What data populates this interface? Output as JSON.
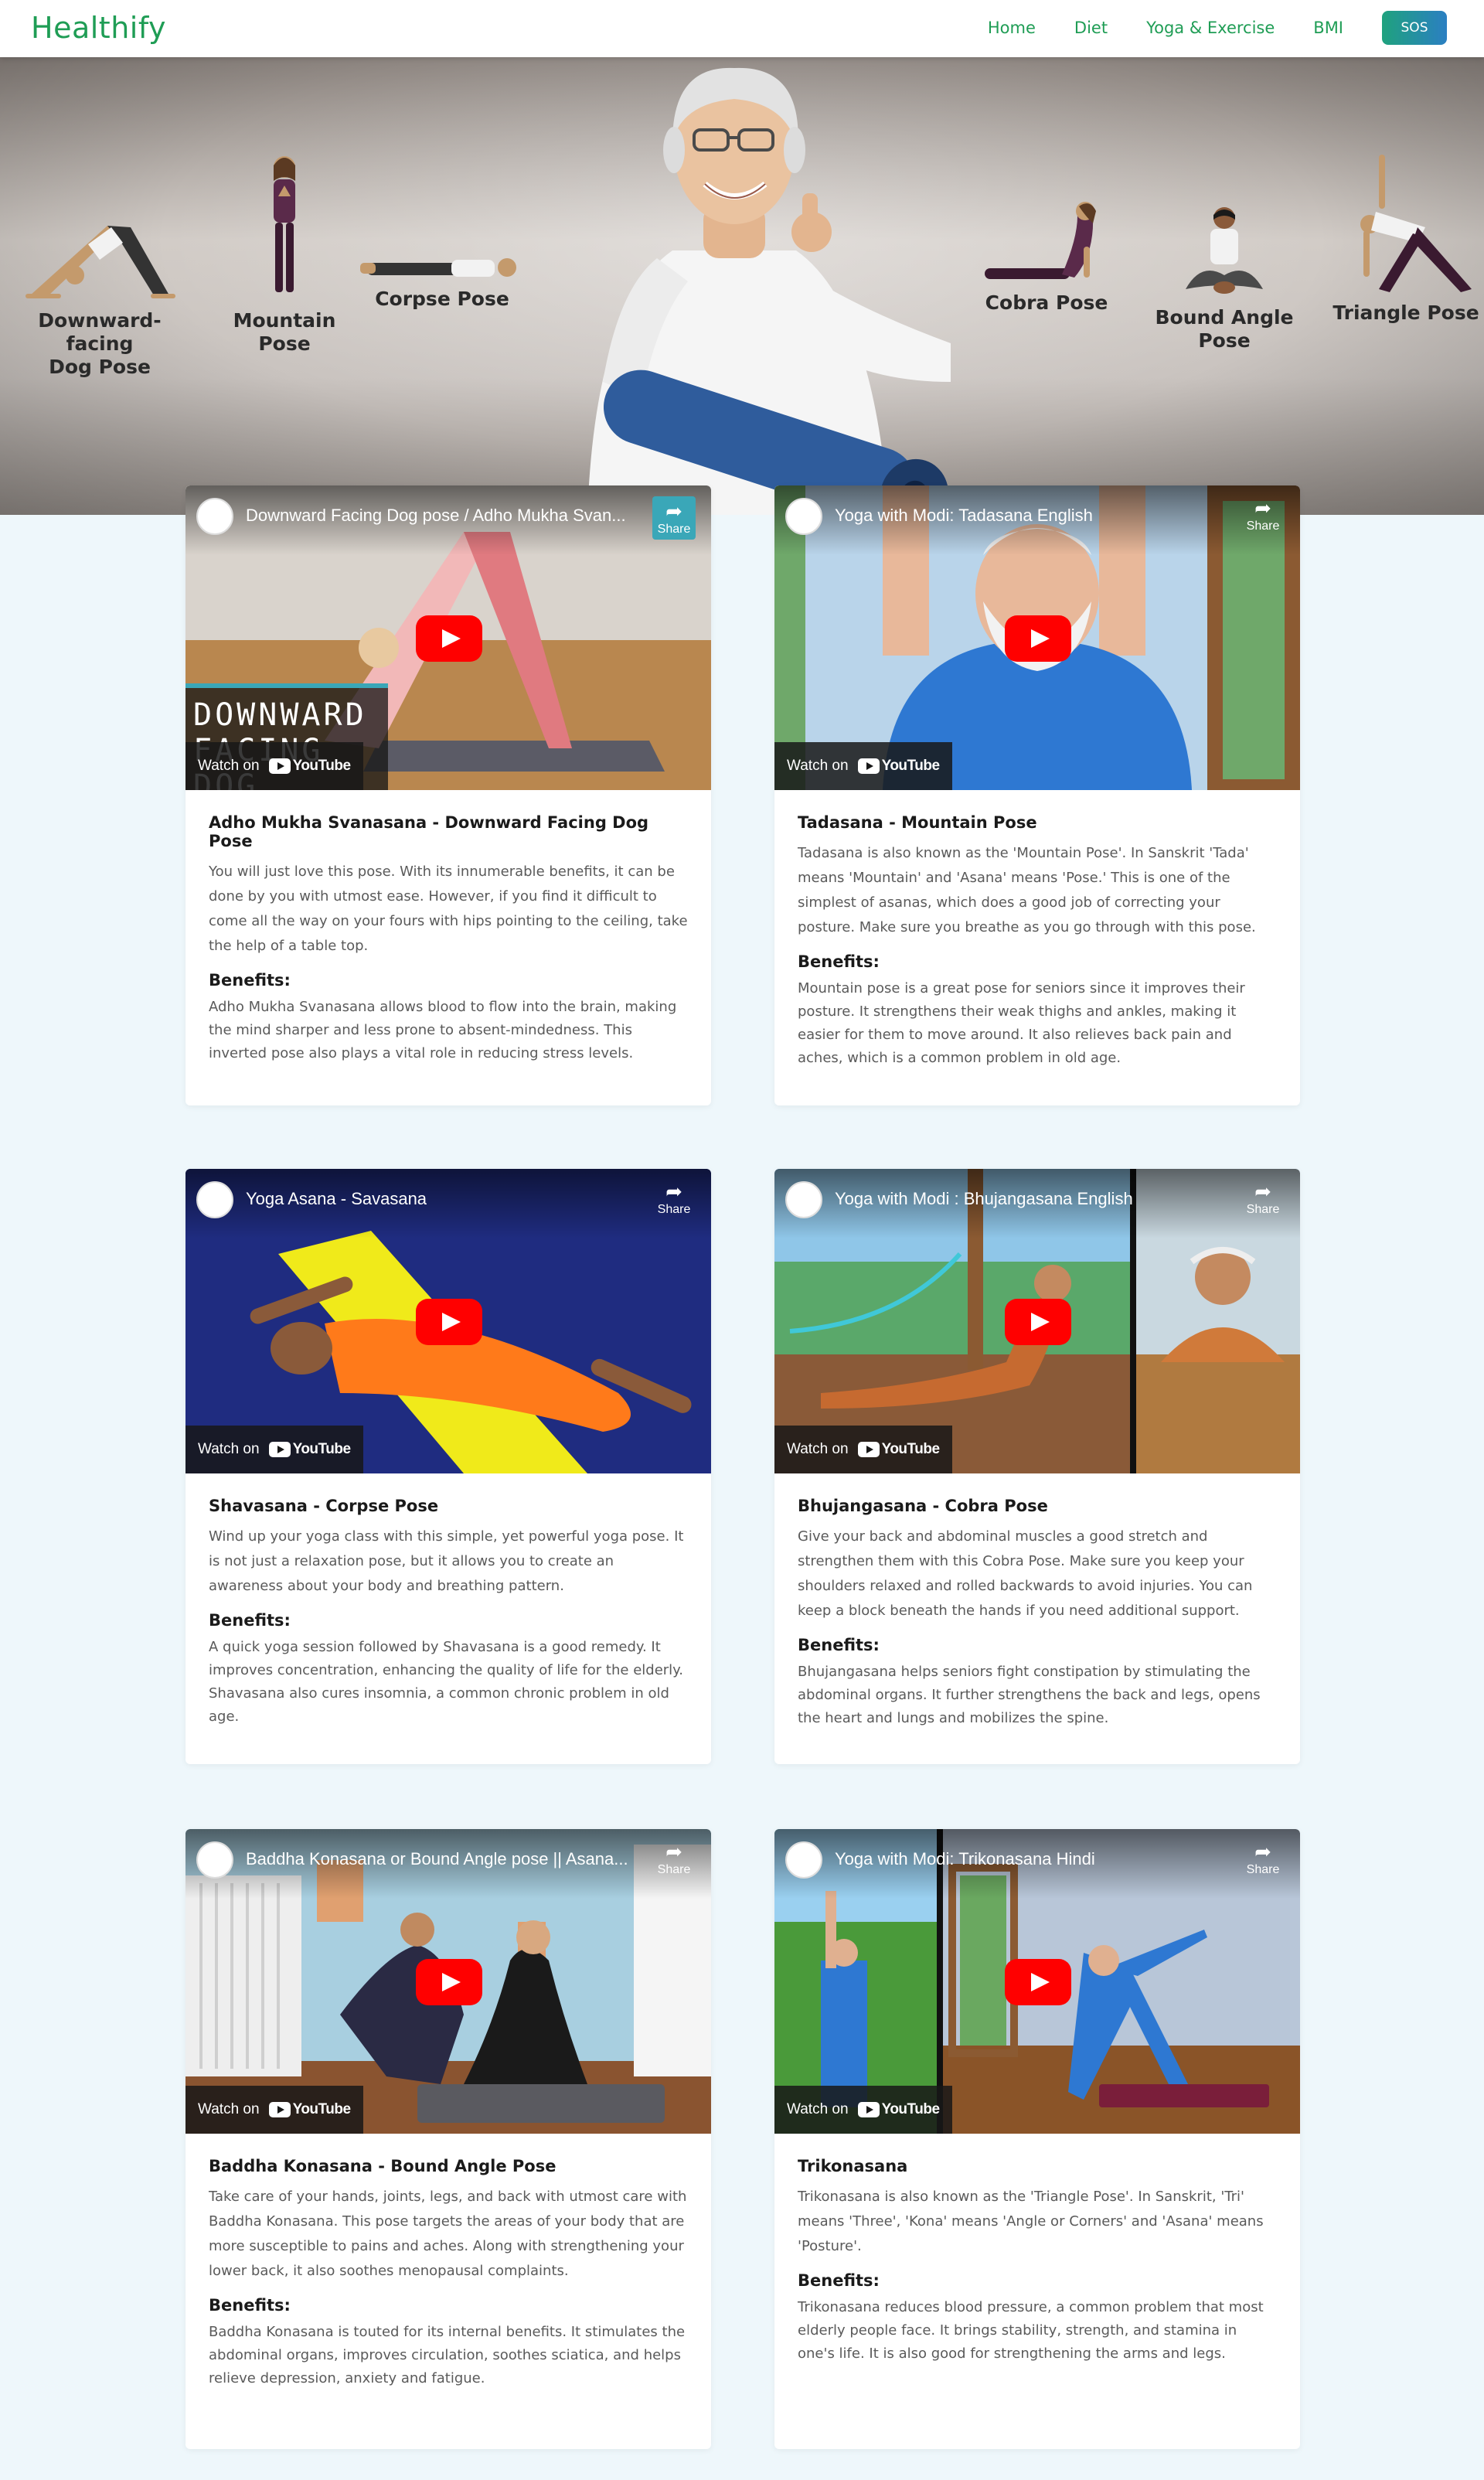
{
  "navbar": {
    "brand": "Healthify",
    "links": [
      "Home",
      "Diet",
      "Yoga & Exercise",
      "BMI"
    ],
    "sos_label": "SOS",
    "accent_color": "#1f9d55"
  },
  "hero": {
    "poses_left": [
      {
        "label_l1": "Downward-facing",
        "label_l2": "Dog Pose"
      },
      {
        "label_l1": "Mountain Pose",
        "label_l2": ""
      },
      {
        "label_l1": "Corpse Pose",
        "label_l2": ""
      }
    ],
    "poses_right": [
      {
        "label_l1": "Cobra Pose",
        "label_l2": ""
      },
      {
        "label_l1": "Bound Angle",
        "label_l2": "Pose"
      },
      {
        "label_l1": "Triangle Pose",
        "label_l2": ""
      }
    ]
  },
  "video_common": {
    "share_label": "Share",
    "watch_on": "Watch on",
    "youtube": "YouTube"
  },
  "cards": [
    {
      "video_title": "Downward Facing Dog pose / Adho Mukha Svan...",
      "title": "Adho Mukha Svanasana - Downward Facing Dog Pose",
      "description": "You will just love this pose. With its innumerable benefits, it can be done by you with utmost ease. However, if you find it difficult to come all the way on your fours with hips pointing to the ceiling, take the help of a table top.",
      "benefits_heading": "Benefits:",
      "benefits": "Adho Mukha Svanasana allows blood to flow into the brain, making the mind sharper and less prone to absent-mindedness. This inverted pose also plays a vital role in reducing stress levels.",
      "overlay_text": "DOWNWARD FACING DOG"
    },
    {
      "video_title": "Yoga with Modi: Tadasana English",
      "title": "Tadasana - Mountain Pose",
      "description": "Tadasana is also known as the 'Mountain Pose'. In Sanskrit 'Tada' means 'Mountain' and 'Asana' means 'Pose.' This is one of the simplest of asanas, which does a good job of correcting your posture. Make sure you breathe as you go through with this pose.",
      "benefits_heading": "Benefits:",
      "benefits": "Mountain pose is a great pose for seniors since it improves their posture. It strengthens their weak thighs and ankles, making it easier for them to move around. It also relieves back pain and aches, which is a common problem in old age."
    },
    {
      "video_title": "Yoga Asana - Savasana",
      "title": "Shavasana - Corpse Pose",
      "description": "Wind up your yoga class with this simple, yet powerful yoga pose. It is not just a relaxation pose, but it allows you to create an awareness about your body and breathing pattern.",
      "benefits_heading": "Benefits:",
      "benefits": "A quick yoga session followed by Shavasana is a good remedy. It improves concentration, enhancing the quality of life for the elderly. Shavasana also cures insomnia, a common chronic problem in old age."
    },
    {
      "video_title": "Yoga with Modi : Bhujangasana English",
      "title": "Bhujangasana - Cobra Pose",
      "description": "Give your back and abdominal muscles a good stretch and strengthen them with this Cobra Pose. Make sure you keep your shoulders relaxed and rolled backwards to avoid injuries. You can keep a block beneath the hands if you need additional support.",
      "benefits_heading": "Benefits:",
      "benefits": "Bhujangasana helps seniors fight constipation by stimulating the abdominal organs. It further strengthens the back and legs, opens the heart and lungs and mobilizes the spine."
    },
    {
      "video_title": "Baddha Konasana or Bound Angle pose || Asana...",
      "title": "Baddha Konasana - Bound Angle Pose",
      "description": "Take care of your hands, joints, legs, and back with utmost care with Baddha Konasana. This pose targets the areas of your body that are more susceptible to pains and aches. Along with strengthening your lower back, it also soothes menopausal complaints.",
      "benefits_heading": "Benefits:",
      "benefits": "Baddha Konasana is touted for its internal benefits. It stimulates the abdominal organs, improves circulation, soothes sciatica, and helps relieve depression, anxiety and fatigue."
    },
    {
      "video_title": "Yoga with Modi: Trikonasana Hindi",
      "title": "Trikonasana",
      "description": "Trikonasana is also known as the 'Triangle Pose'. In Sanskrit, 'Tri' means 'Three', 'Kona' means 'Angle or Corners' and 'Asana' means 'Posture'.",
      "benefits_heading": "Benefits:",
      "benefits": "Trikonasana reduces blood pressure, a common problem that most elderly people face. It brings stability, strength, and stamina in one's life. It is also good for strengthening the arms and legs."
    }
  ]
}
